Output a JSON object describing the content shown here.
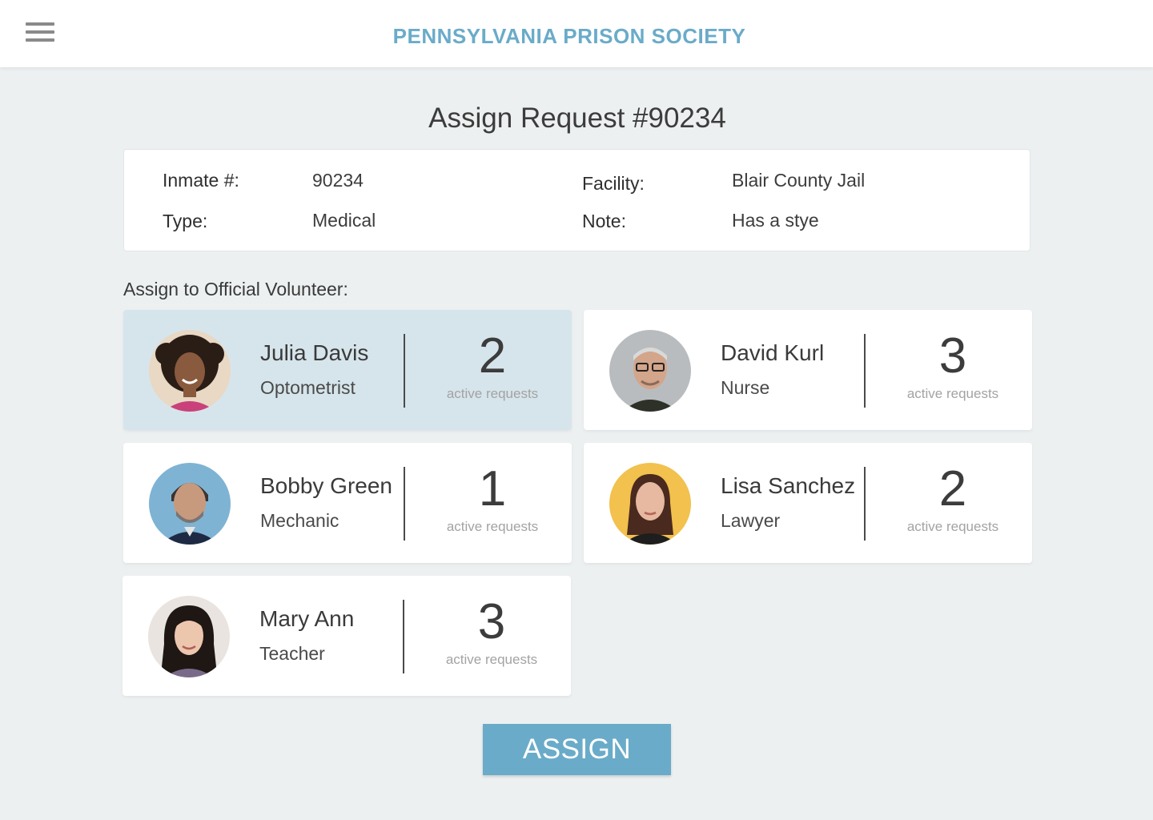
{
  "header": {
    "brand": "PENNSYLVANIA PRISON SOCIETY",
    "menu_icon": "hamburger-menu-icon"
  },
  "page": {
    "title": "Assign Request #90234"
  },
  "request": {
    "inmate_label": "Inmate #:",
    "inmate_value": "90234",
    "type_label": "Type:",
    "type_value": "Medical",
    "facility_label": "Facility:",
    "facility_value": "Blair County Jail",
    "note_label": "Note:",
    "note_value": "Has a stye"
  },
  "volunteers_section": {
    "label": "Assign to Official Volunteer:"
  },
  "volunteers": [
    {
      "name": "Julia Davis",
      "role": "Optometrist",
      "count": "2",
      "count_label": "active requests",
      "selected": true
    },
    {
      "name": "David Kurl",
      "role": "Nurse",
      "count": "3",
      "count_label": "active requests",
      "selected": false
    },
    {
      "name": "Bobby Green",
      "role": "Mechanic",
      "count": "1",
      "count_label": "active requests",
      "selected": false
    },
    {
      "name": "Lisa Sanchez",
      "role": "Lawyer",
      "count": "2",
      "count_label": "active requests",
      "selected": false
    },
    {
      "name": "Mary Ann",
      "role": "Teacher",
      "count": "3",
      "count_label": "active requests",
      "selected": false
    }
  ],
  "actions": {
    "assign_label": "ASSIGN"
  },
  "colors": {
    "accent": "#6aabc9",
    "selected_card": "#d6e5eb",
    "background": "#ecf0f1"
  }
}
